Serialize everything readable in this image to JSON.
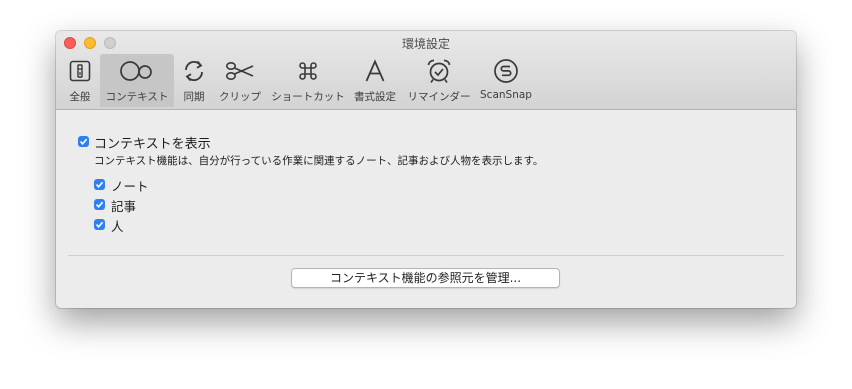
{
  "window": {
    "title": "環境設定"
  },
  "toolbar": {
    "items": [
      {
        "label": "全般",
        "icon": "general-switch-icon"
      },
      {
        "label": "コンテキスト",
        "icon": "context-icon",
        "selected": true
      },
      {
        "label": "同期",
        "icon": "sync-arrows-icon"
      },
      {
        "label": "クリップ",
        "icon": "scissors-icon"
      },
      {
        "label": "ショートカット",
        "icon": "command-key-icon"
      },
      {
        "label": "書式設定",
        "icon": "font-a-icon"
      },
      {
        "label": "リマインダー",
        "icon": "alarm-clock-icon"
      },
      {
        "label": "ScanSnap",
        "icon": "scansnap-icon"
      }
    ]
  },
  "context": {
    "show_label": "コンテキストを表示",
    "show_checked": true,
    "description": "コンテキスト機能は、自分が行っている作業に関連するノート、記事および人物を表示します。",
    "options": [
      {
        "label": "ノート",
        "checked": true
      },
      {
        "label": "記事",
        "checked": true
      },
      {
        "label": "人",
        "checked": true
      }
    ],
    "manage_button": "コンテキスト機能の参照元を管理..."
  },
  "colors": {
    "accent": "#2e80f0",
    "selected_tab_bg": "#c6c6c6"
  }
}
